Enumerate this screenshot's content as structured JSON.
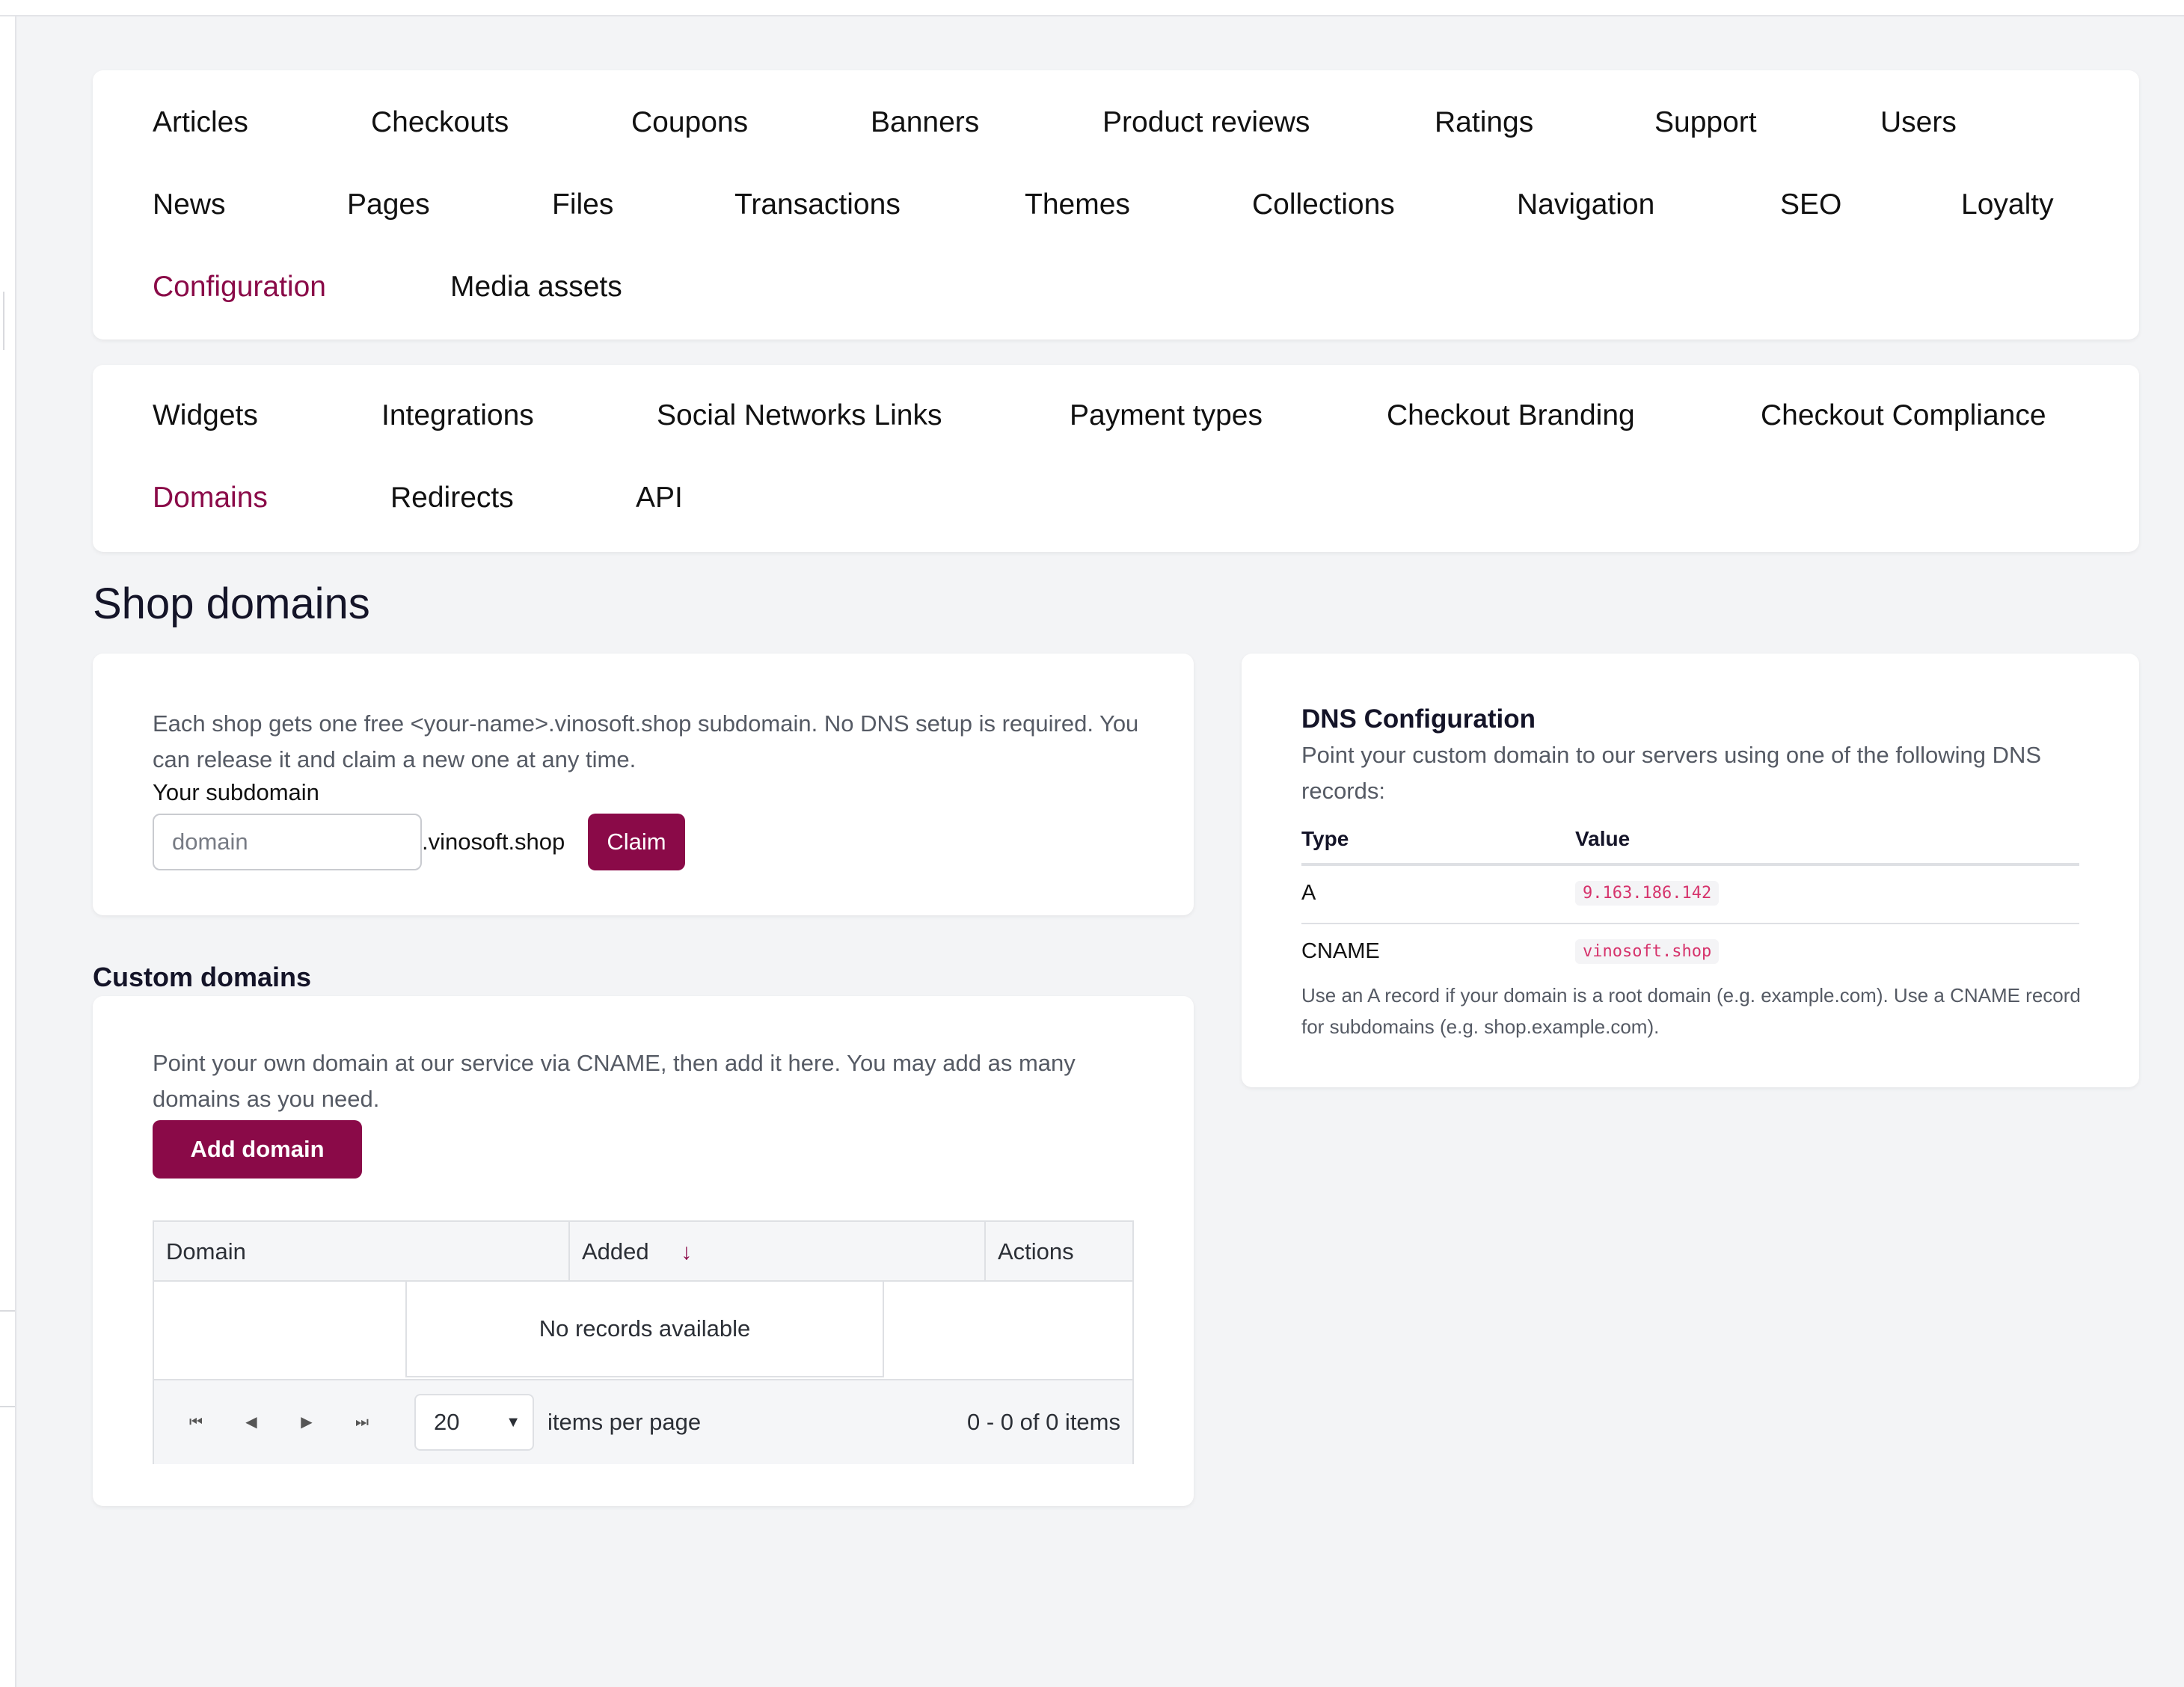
{
  "nav": {
    "primary": [
      {
        "label": "Articles",
        "active": false
      },
      {
        "label": "Checkouts",
        "active": false
      },
      {
        "label": "Coupons",
        "active": false
      },
      {
        "label": "Banners",
        "active": false
      },
      {
        "label": "Product reviews",
        "active": false
      },
      {
        "label": "Ratings",
        "active": false
      },
      {
        "label": "Support",
        "active": false
      },
      {
        "label": "Users",
        "active": false
      },
      {
        "label": "News",
        "active": false
      },
      {
        "label": "Pages",
        "active": false
      },
      {
        "label": "Files",
        "active": false
      },
      {
        "label": "Transactions",
        "active": false
      },
      {
        "label": "Themes",
        "active": false
      },
      {
        "label": "Collections",
        "active": false
      },
      {
        "label": "Navigation",
        "active": false
      },
      {
        "label": "SEO",
        "active": false
      },
      {
        "label": "Loyalty",
        "active": false
      },
      {
        "label": "Configuration",
        "active": true
      },
      {
        "label": "Media assets",
        "active": false
      }
    ],
    "secondary": [
      {
        "label": "Widgets",
        "active": false
      },
      {
        "label": "Integrations",
        "active": false
      },
      {
        "label": "Social Networks Links",
        "active": false
      },
      {
        "label": "Payment types",
        "active": false
      },
      {
        "label": "Checkout Branding",
        "active": false
      },
      {
        "label": "Checkout Compliance",
        "active": false
      },
      {
        "label": "Domains",
        "active": true
      },
      {
        "label": "Redirects",
        "active": false
      },
      {
        "label": "API",
        "active": false
      }
    ]
  },
  "page": {
    "title": "Shop domains"
  },
  "subdomain": {
    "description": "Each shop gets one free <your-name>.vinosoft.shop subdomain. No DNS setup is required. You can release it and claim a new one at any time.",
    "label": "Your subdomain",
    "placeholder": "domain",
    "suffix": ".vinosoft.shop",
    "claim_label": "Claim"
  },
  "custom": {
    "heading": "Custom domains",
    "description": "Point your own domain at our service via CNAME, then add it here. You may add as many domains as you need.",
    "add_label": "Add domain",
    "columns": [
      "Domain",
      "Added",
      "Actions"
    ],
    "sort_icon": "arrow-down",
    "empty_text": "No records available",
    "page_size": "20",
    "per_page_label": "items per page",
    "range_text": "0 - 0 of 0 items"
  },
  "dns": {
    "heading": "DNS Configuration",
    "description": "Point your custom domain to our servers using one of the following DNS records:",
    "col_type": "Type",
    "col_value": "Value",
    "records": [
      {
        "type": "A",
        "value": "9.163.186.142"
      },
      {
        "type": "CNAME",
        "value": "vinosoft.shop"
      }
    ],
    "note": "Use an A record if your domain is a root domain (e.g. example.com). Use a CNAME record for subdomains (e.g. shop.example.com)."
  },
  "colors": {
    "accent": "#8a0a48",
    "code": "#d6336c",
    "background": "#f3f4f6"
  }
}
